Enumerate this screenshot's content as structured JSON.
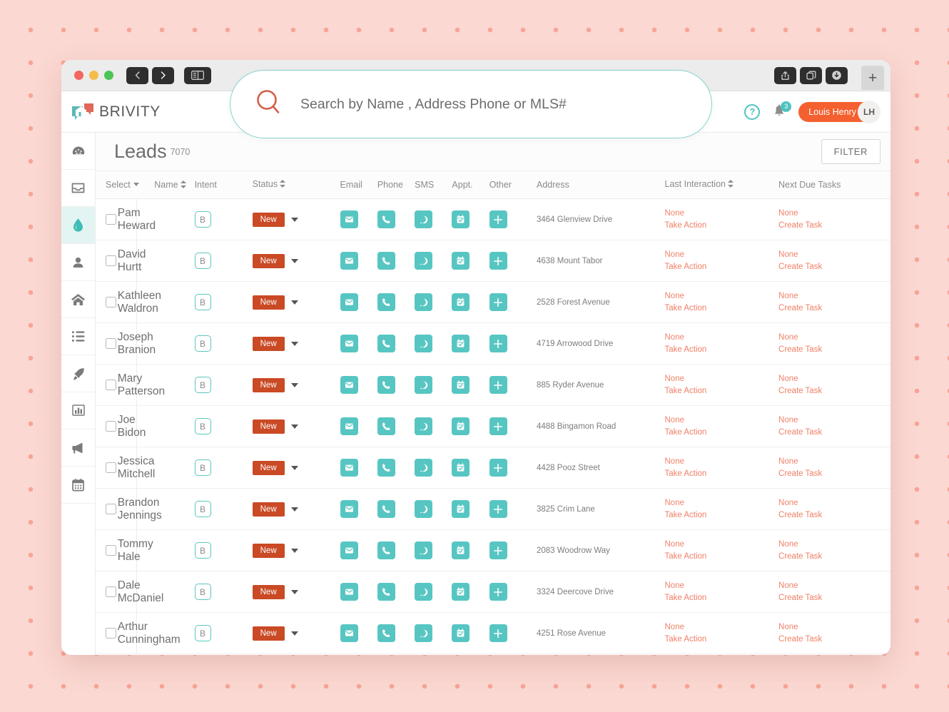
{
  "browser": {
    "back_label": "back-arrow",
    "forward_label": "forward-arrow",
    "sidebar_toggle_label": "sidebar-toggle",
    "share_label": "share",
    "tabs_label": "tabs-overview",
    "download_label": "downloads",
    "new_tab_label": "+"
  },
  "app": {
    "brand": "BRIVITY",
    "help_label": "?",
    "notification_count": "3",
    "user_name": "Louis Henry",
    "user_initials": "LH"
  },
  "search": {
    "placeholder": "Search by Name , Address Phone or MLS#",
    "value": ""
  },
  "sidebar": {
    "items": [
      {
        "icon": "dashboard-gauge-icon",
        "active": false
      },
      {
        "icon": "inbox-icon",
        "active": false
      },
      {
        "icon": "water-drop-icon",
        "active": true
      },
      {
        "icon": "person-icon",
        "active": false
      },
      {
        "icon": "home-icon",
        "active": false
      },
      {
        "icon": "list-icon",
        "active": false
      },
      {
        "icon": "rocket-icon",
        "active": false
      },
      {
        "icon": "bar-chart-icon",
        "active": false
      },
      {
        "icon": "megaphone-icon",
        "active": false
      },
      {
        "icon": "calendar-icon",
        "active": false
      }
    ]
  },
  "page": {
    "title": "Leads",
    "count": "7070",
    "filter_label": "FILTER"
  },
  "table": {
    "headers": {
      "select": "Select",
      "name": "Name",
      "intent": "Intent",
      "status": "Status",
      "email": "Email",
      "phone": "Phone",
      "sms": "SMS",
      "appt": "Appt.",
      "other": "Other",
      "address": "Address",
      "last_interaction": "Last Interaction",
      "next_due_tasks": "Next Due Tasks"
    },
    "action_icons": [
      "envelope-icon",
      "phone-icon",
      "chat-bubble-icon",
      "calendar-check-icon",
      "plus-icon"
    ],
    "rows": [
      {
        "name": "Pam Heward",
        "intent": "B",
        "status": "New",
        "address": "3464 Glenview Drive",
        "last_interaction": "None",
        "last_action": "Take Action",
        "next_due": "None",
        "next_action": "Create Task"
      },
      {
        "name": "David Hurtt",
        "intent": "B",
        "status": "New",
        "address": "4638 Mount Tabor",
        "last_interaction": "None",
        "last_action": "Take Action",
        "next_due": "None",
        "next_action": "Create Task"
      },
      {
        "name": "Kathleen Waldron",
        "intent": "B",
        "status": "New",
        "address": "2528 Forest Avenue",
        "last_interaction": "None",
        "last_action": "Take Action",
        "next_due": "None",
        "next_action": "Create Task"
      },
      {
        "name": "Joseph Branion",
        "intent": "B",
        "status": "New",
        "address": "4719 Arrowood Drive",
        "last_interaction": "None",
        "last_action": "Take Action",
        "next_due": "None",
        "next_action": "Create Task"
      },
      {
        "name": "Mary Patterson",
        "intent": "B",
        "status": "New",
        "address": "885 Ryder Avenue",
        "last_interaction": "None",
        "last_action": "Take Action",
        "next_due": "None",
        "next_action": "Create Task"
      },
      {
        "name": "Joe Bidon",
        "intent": "B",
        "status": "New",
        "address": "4488 Bingamon Road",
        "last_interaction": "None",
        "last_action": "Take Action",
        "next_due": "None",
        "next_action": "Create Task"
      },
      {
        "name": "Jessica Mitchell",
        "intent": "B",
        "status": "New",
        "address": "4428 Pooz Street",
        "last_interaction": "None",
        "last_action": "Take Action",
        "next_due": "None",
        "next_action": "Create Task"
      },
      {
        "name": "Brandon Jennings",
        "intent": "B",
        "status": "New",
        "address": "3825 Crim Lane",
        "last_interaction": "None",
        "last_action": "Take Action",
        "next_due": "None",
        "next_action": "Create Task"
      },
      {
        "name": "Tommy Hale",
        "intent": "B",
        "status": "New",
        "address": "2083 Woodrow Way",
        "last_interaction": "None",
        "last_action": "Take Action",
        "next_due": "None",
        "next_action": "Create Task"
      },
      {
        "name": "Dale McDaniel",
        "intent": "B",
        "status": "New",
        "address": "3324 Deercove Drive",
        "last_interaction": "None",
        "last_action": "Take Action",
        "next_due": "None",
        "next_action": "Create Task"
      },
      {
        "name": "Arthur Cunningham",
        "intent": "B",
        "status": "New",
        "address": "4251 Rose Avenue",
        "last_interaction": "None",
        "last_action": "Take Action",
        "next_due": "None",
        "next_action": "Create Task"
      }
    ]
  },
  "colors": {
    "teal": "#57c6c2",
    "orange": "#f4602f",
    "rust": "#c94a24",
    "coral_text": "#f0836a",
    "background_pink": "#fbd8d2",
    "dot_pink": "#f8a496"
  }
}
